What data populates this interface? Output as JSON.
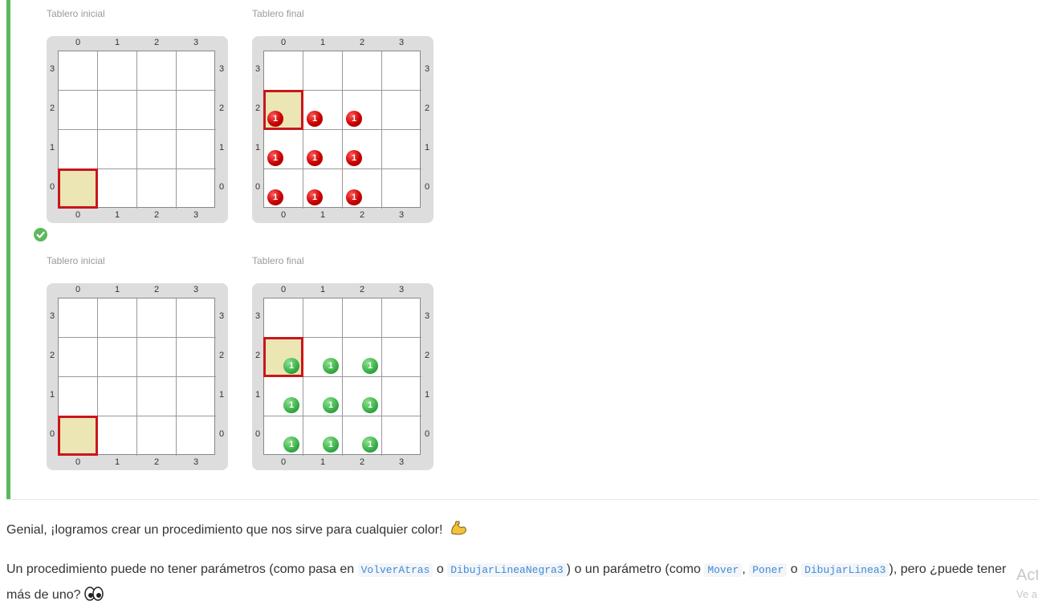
{
  "examples": [
    {
      "initial_label": "Tablero inicial",
      "final_label": "Tablero final",
      "initial": {
        "cursor": {
          "col": 0,
          "row": 0
        },
        "balls": []
      },
      "final": {
        "cursor": {
          "col": 0,
          "row": 2
        },
        "balls": [
          {
            "col": 0,
            "row": 2,
            "color": "red",
            "count": "1"
          },
          {
            "col": 1,
            "row": 2,
            "color": "red",
            "count": "1"
          },
          {
            "col": 2,
            "row": 2,
            "color": "red",
            "count": "1"
          },
          {
            "col": 0,
            "row": 1,
            "color": "red",
            "count": "1"
          },
          {
            "col": 1,
            "row": 1,
            "color": "red",
            "count": "1"
          },
          {
            "col": 2,
            "row": 1,
            "color": "red",
            "count": "1"
          },
          {
            "col": 0,
            "row": 0,
            "color": "red",
            "count": "1"
          },
          {
            "col": 1,
            "row": 0,
            "color": "red",
            "count": "1"
          },
          {
            "col": 2,
            "row": 0,
            "color": "red",
            "count": "1"
          }
        ]
      }
    },
    {
      "initial_label": "Tablero inicial",
      "final_label": "Tablero final",
      "initial": {
        "cursor": {
          "col": 0,
          "row": 0
        },
        "balls": []
      },
      "final": {
        "cursor": {
          "col": 0,
          "row": 2
        },
        "balls": [
          {
            "col": 0,
            "row": 2,
            "color": "green",
            "count": "1"
          },
          {
            "col": 1,
            "row": 2,
            "color": "green",
            "count": "1"
          },
          {
            "col": 2,
            "row": 2,
            "color": "green",
            "count": "1"
          },
          {
            "col": 0,
            "row": 1,
            "color": "green",
            "count": "1"
          },
          {
            "col": 1,
            "row": 1,
            "color": "green",
            "count": "1"
          },
          {
            "col": 2,
            "row": 1,
            "color": "green",
            "count": "1"
          },
          {
            "col": 0,
            "row": 0,
            "color": "green",
            "count": "1"
          },
          {
            "col": 1,
            "row": 0,
            "color": "green",
            "count": "1"
          },
          {
            "col": 2,
            "row": 0,
            "color": "green",
            "count": "1"
          }
        ]
      }
    }
  ],
  "board_coords": {
    "cols": [
      "0",
      "1",
      "2",
      "3"
    ],
    "rows": [
      "0",
      "1",
      "2",
      "3"
    ]
  },
  "colors": {
    "success": "#5cb85c",
    "cursor_border": "#c8161d",
    "cursor_fill": "#ebe6b4",
    "red_ball": "#c90000",
    "green_ball": "#3cb44b"
  },
  "icons": {
    "success": "check-circle-icon",
    "muscle": "flexed-biceps-emoji",
    "eyes": "eyes-emoji"
  },
  "text": {
    "p1": "Genial, ¡logramos crear un procedimiento que nos sirve para cualquier color!",
    "p2_a": "Un procedimiento puede no tener parámetros (como pasa en",
    "p2_code1": "VolverAtras",
    "p2_b": "o",
    "p2_code2": "DibujarLineaNegra3",
    "p2_c": ") o un parámetro (como",
    "p2_code3": "Mover",
    "p2_d": ",",
    "p2_code4": "Poner",
    "p2_e": "o",
    "p2_code5": "DibujarLinea3",
    "p2_f": "), pero ¿puede tener",
    "p2_line2": "más de uno?"
  },
  "watermark": {
    "line1": "Act",
    "line2": "Ve a"
  }
}
